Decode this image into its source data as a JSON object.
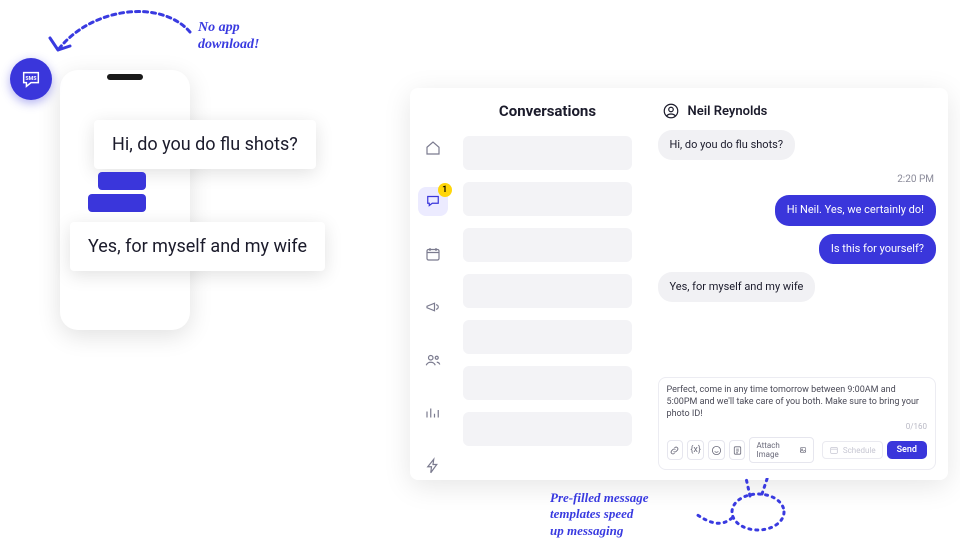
{
  "annotations": {
    "no_app": "No app\ndownload!",
    "templates": "Pre-filled message\ntemplates speed\nup messaging"
  },
  "phone": {
    "bubble_in": "Hi, do you do flu shots?",
    "bubble_reply": "Yes, for myself and my wife"
  },
  "nav": {
    "unread_count": "1",
    "icons": [
      "home-icon",
      "chat-icon",
      "calendar-icon",
      "megaphone-icon",
      "people-icon",
      "analytics-icon",
      "bolt-icon"
    ]
  },
  "conversations": {
    "title": "Conversations"
  },
  "chat": {
    "contact_name": "Neil Reynolds",
    "messages": {
      "in1": "Hi, do you do flu shots?",
      "time1": "2:20 PM",
      "out1": "Hi Neil. Yes, we certainly do!",
      "out2": "Is this for yourself?",
      "in2": "Yes, for myself and my wife"
    },
    "composer": {
      "draft": "Perfect, come in any time tomorrow between 9:00AM and 5:00PM and we'll take care of you both. Make sure to bring your photo ID!",
      "counter": "0/160",
      "attach_label": "Attach Image",
      "schedule_label": "Schedule",
      "send_label": "Send"
    }
  },
  "sms_label": "SMS"
}
